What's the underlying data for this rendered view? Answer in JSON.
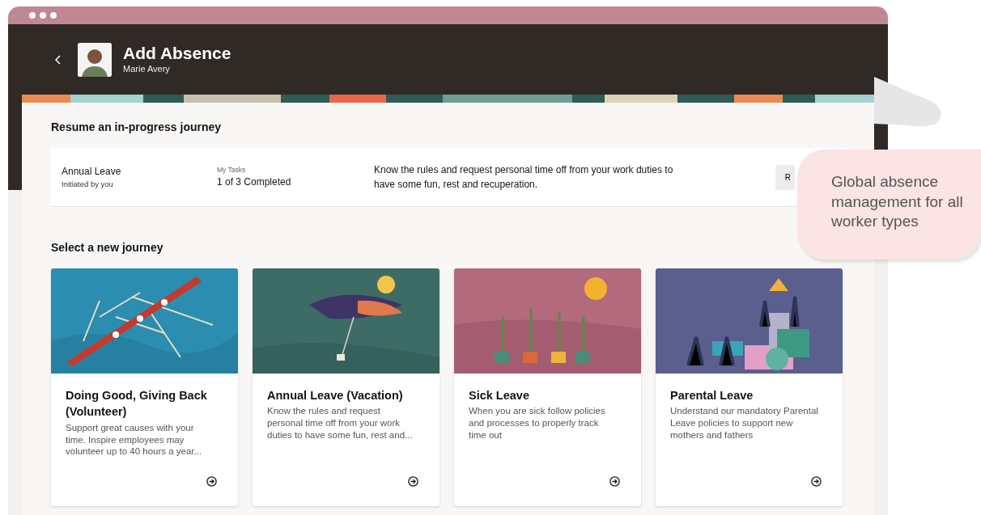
{
  "header": {
    "title": "Add Absence",
    "subtitle": "Marie Avery"
  },
  "resume": {
    "heading": "Resume an in-progress journey",
    "item": {
      "name": "Annual Leave",
      "initiator": "Initiated by you",
      "tasks_label": "My Tasks",
      "tasks_value": "1 of 3 Completed",
      "description": "Know the rules and request personal time off from your work duties to have some fun, rest and recuperation.",
      "button": "R"
    }
  },
  "new_journey": {
    "heading": "Select a new journey",
    "cards": [
      {
        "title": "Doing Good, Giving Back (Volunteer)",
        "description": "Support great causes with your time. Inspire employees may volunteer up to 40 hours a year..."
      },
      {
        "title": "Annual Leave (Vacation)",
        "description": "Know the rules and request personal time off from your work duties to have some fun, rest and..."
      },
      {
        "title": "Sick Leave",
        "description": "When you are sick follow policies and processes to properly track time out"
      },
      {
        "title": "Parental Leave",
        "description": "Understand our mandatory Parental Leave policies to support new mothers and fathers"
      }
    ]
  },
  "callout": {
    "text": "Global absence management for all worker types"
  }
}
